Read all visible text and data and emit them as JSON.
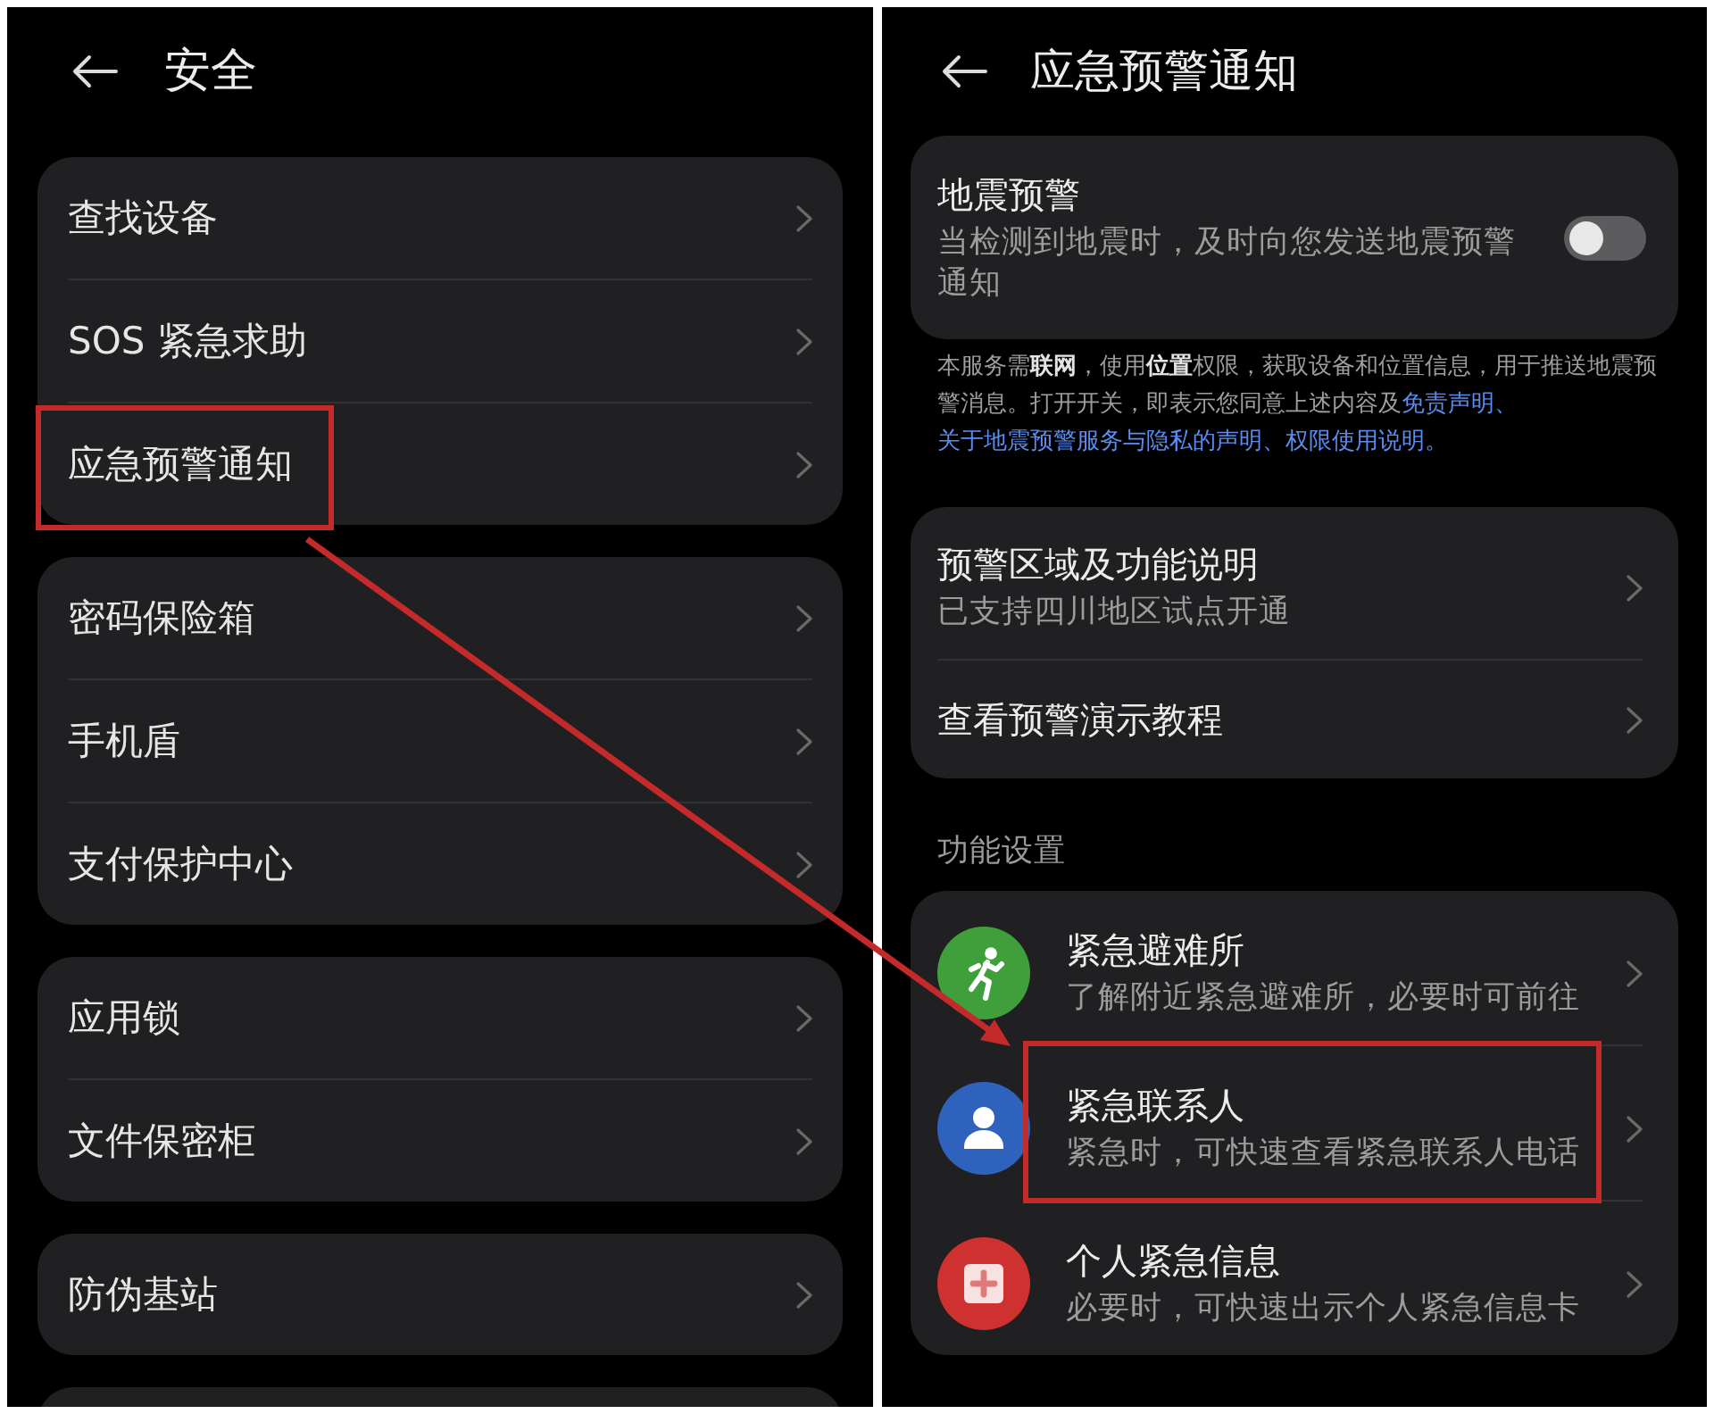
{
  "left_screen": {
    "title": "安全",
    "groups": [
      {
        "items": [
          {
            "label": "查找设备",
            "highlighted": false
          },
          {
            "label": "SOS 紧急求助",
            "highlighted": false
          },
          {
            "label": "应急预警通知",
            "highlighted": true
          }
        ]
      },
      {
        "items": [
          {
            "label": "密码保险箱",
            "highlighted": false
          },
          {
            "label": "手机盾",
            "highlighted": false
          },
          {
            "label": "支付保护中心",
            "highlighted": false
          }
        ]
      },
      {
        "items": [
          {
            "label": "应用锁",
            "highlighted": false
          },
          {
            "label": "文件保密柜",
            "highlighted": false
          }
        ]
      },
      {
        "items": [
          {
            "label": "防伪基站",
            "highlighted": false
          }
        ]
      }
    ]
  },
  "right_screen": {
    "title": "应急预警通知",
    "earthquake_alert": {
      "title": "地震预警",
      "description": "当检测到地震时，及时向您发送地震预警通知",
      "on": false
    },
    "notice": [
      {
        "kind": "text",
        "text": "本服务需**联网**，使用**位置**权限，获取设备和位置信息，用于推送地震预警消息。打开开关，即表示您同意上述内容及"
      },
      {
        "kind": "link",
        "text": "免责声明"
      },
      {
        "kind": "separator",
        "text": "、"
      },
      {
        "kind": "link",
        "text": "关于地震预警服务与隐私的声明"
      },
      {
        "kind": "separator",
        "text": "、"
      },
      {
        "kind": "link",
        "text": "权限使用说明"
      },
      {
        "kind": "separator",
        "text": "。"
      }
    ],
    "info_items": [
      {
        "title": "预警区域及功能说明",
        "subtitle": "已支持四川地区试点开通"
      },
      {
        "title": "查看预警演示教程"
      }
    ],
    "section_header": "功能设置",
    "feature_items": [
      {
        "title": "紧急避难所",
        "subtitle": "了解附近紧急避难所，必要时可前往",
        "color": "#3f9f3b",
        "highlighted": false
      },
      {
        "title": "紧急联系人",
        "subtitle": "紧急时，可快速查看紧急联系人电话",
        "color": "#2f62bd",
        "highlighted": true
      },
      {
        "title": "个人紧急信息",
        "subtitle": "必要时，可快速出示个人紧急信息卡",
        "color": "#cf3131",
        "highlighted": false
      }
    ]
  }
}
